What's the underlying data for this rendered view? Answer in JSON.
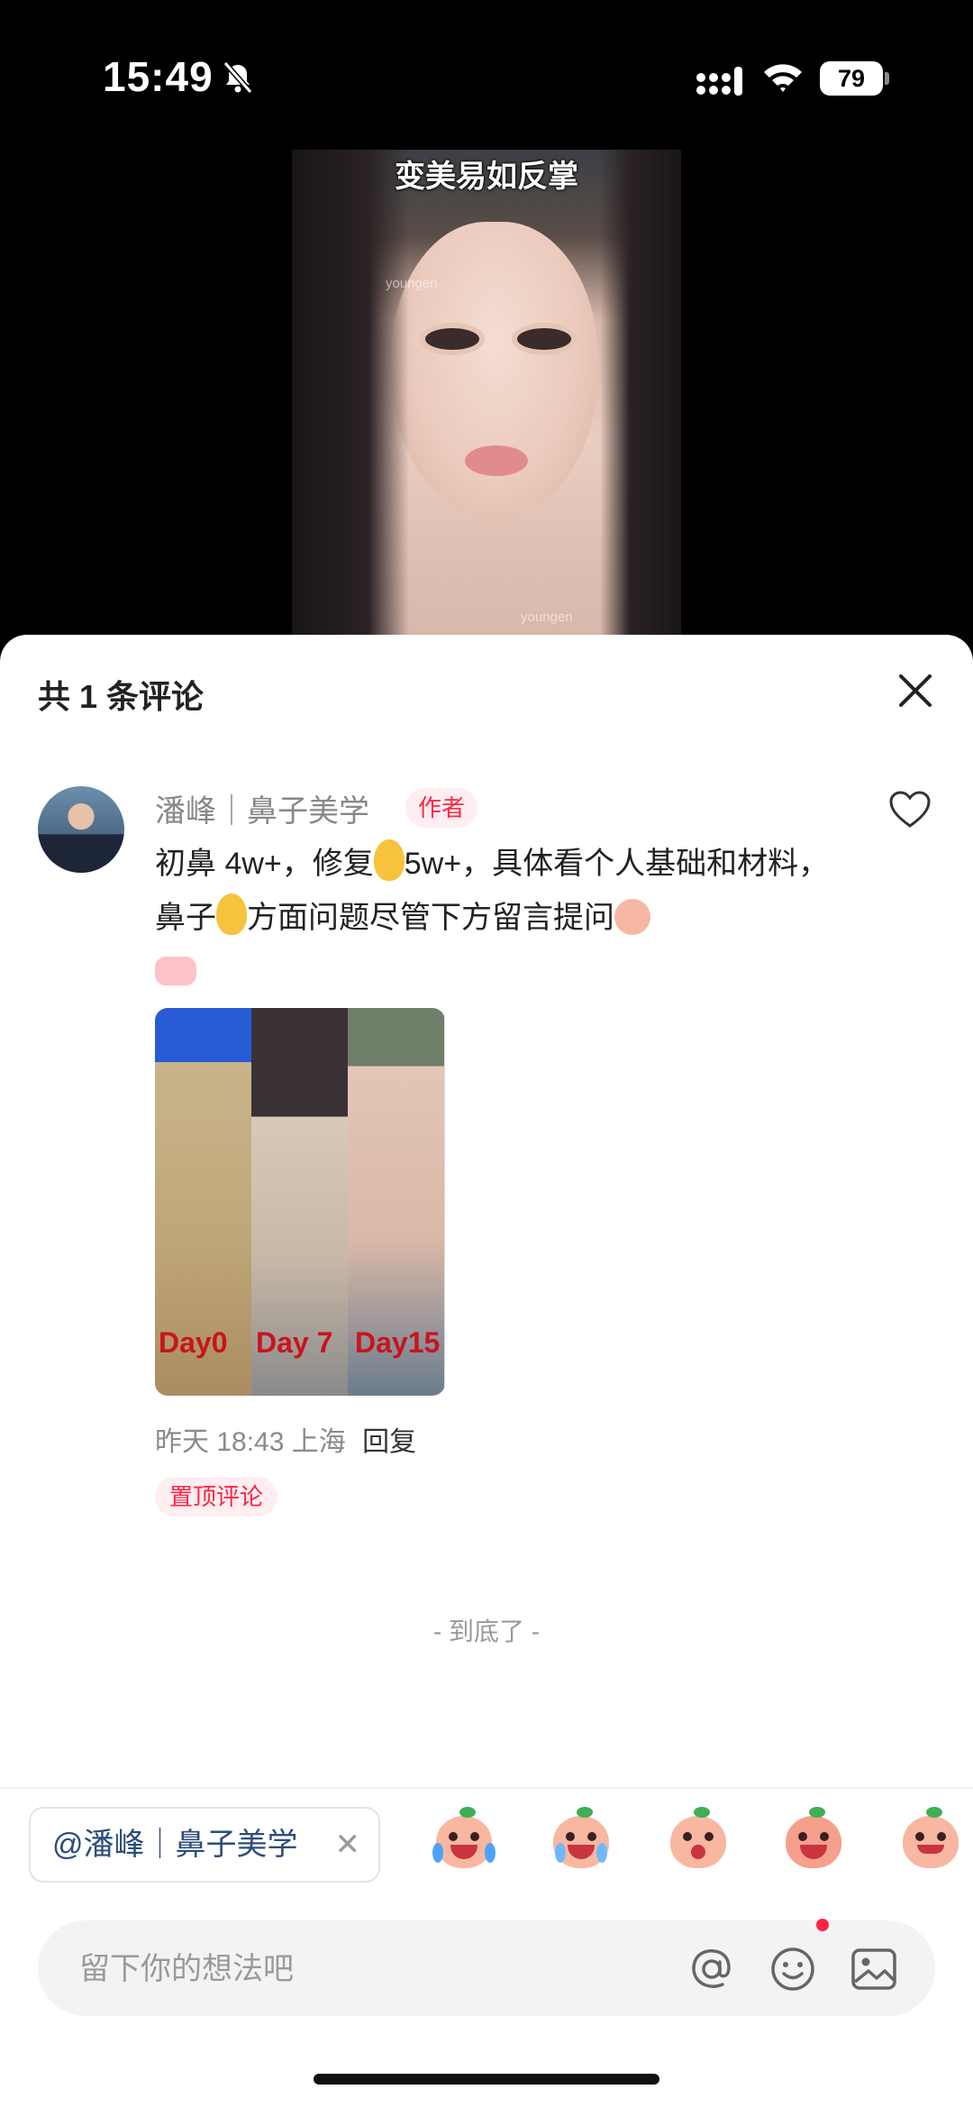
{
  "status_bar": {
    "time": "15:49",
    "battery": "79"
  },
  "video": {
    "caption": "变美易如反掌",
    "watermark": "youngen"
  },
  "comments_sheet": {
    "title": "共 1 条评论",
    "comment": {
      "username": "潘峰｜鼻子美学",
      "author_tag": "作者",
      "text_part1": "初鼻 4w+，修复",
      "text_part2": "5w+，具体看个人基础和材料，鼻子",
      "text_part3": "方面问题尽管下方留言提问",
      "image_labels": [
        "Day0",
        "Day 7",
        "Day15"
      ],
      "time": "昨天 18:43",
      "location": "上海",
      "reply_label": "回复",
      "pinned_tag": "置顶评论"
    },
    "end_text": "- 到底了 -"
  },
  "composer": {
    "mention_chip": "@潘峰｜鼻子美学",
    "placeholder": "留下你的想法吧"
  }
}
